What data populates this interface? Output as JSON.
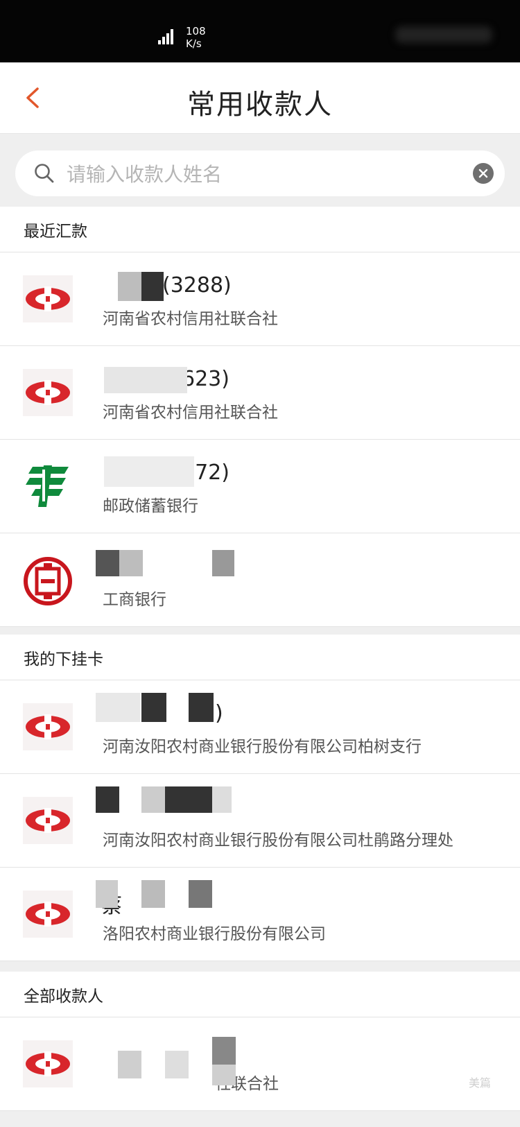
{
  "status_bar": {
    "speed_value": "108",
    "speed_unit": "K/s"
  },
  "header": {
    "title": "常用收款人",
    "back_icon": "chevron-left-icon",
    "accent_color": "#e2572b"
  },
  "search": {
    "placeholder": "请输入收款人姓名",
    "value": ""
  },
  "sections": [
    {
      "title": "最近汇款",
      "rows": [
        {
          "name": "(3288)",
          "bank": "河南省农村信用社联合社",
          "logo": "rural-credit-logo"
        },
        {
          "name": "623)",
          "bank": "河南省农村信用社联合社",
          "logo": "rural-credit-logo"
        },
        {
          "name": "372)",
          "bank": "邮政储蓄银行",
          "logo": "postal-savings-logo"
        },
        {
          "name": ")",
          "bank": "工商银行",
          "logo": "icbc-logo"
        }
      ]
    },
    {
      "title": "我的下挂卡",
      "rows": [
        {
          "name": ")",
          "bank": "河南汝阳农村商业银行股份有限公司柏树支行",
          "logo": "rural-credit-logo"
        },
        {
          "name": "",
          "bank": "河南汝阳农村商业银行股份有限公司杜鹃路分理处",
          "logo": "rural-credit-logo"
        },
        {
          "name": "蔡",
          "bank": "洛阳农村商业银行股份有限公司",
          "logo": "rural-credit-logo"
        }
      ]
    },
    {
      "title": "全部收款人",
      "rows": [
        {
          "name": "",
          "bank": "社联合社",
          "logo": "rural-credit-logo"
        }
      ]
    }
  ],
  "watermark": "美篇"
}
